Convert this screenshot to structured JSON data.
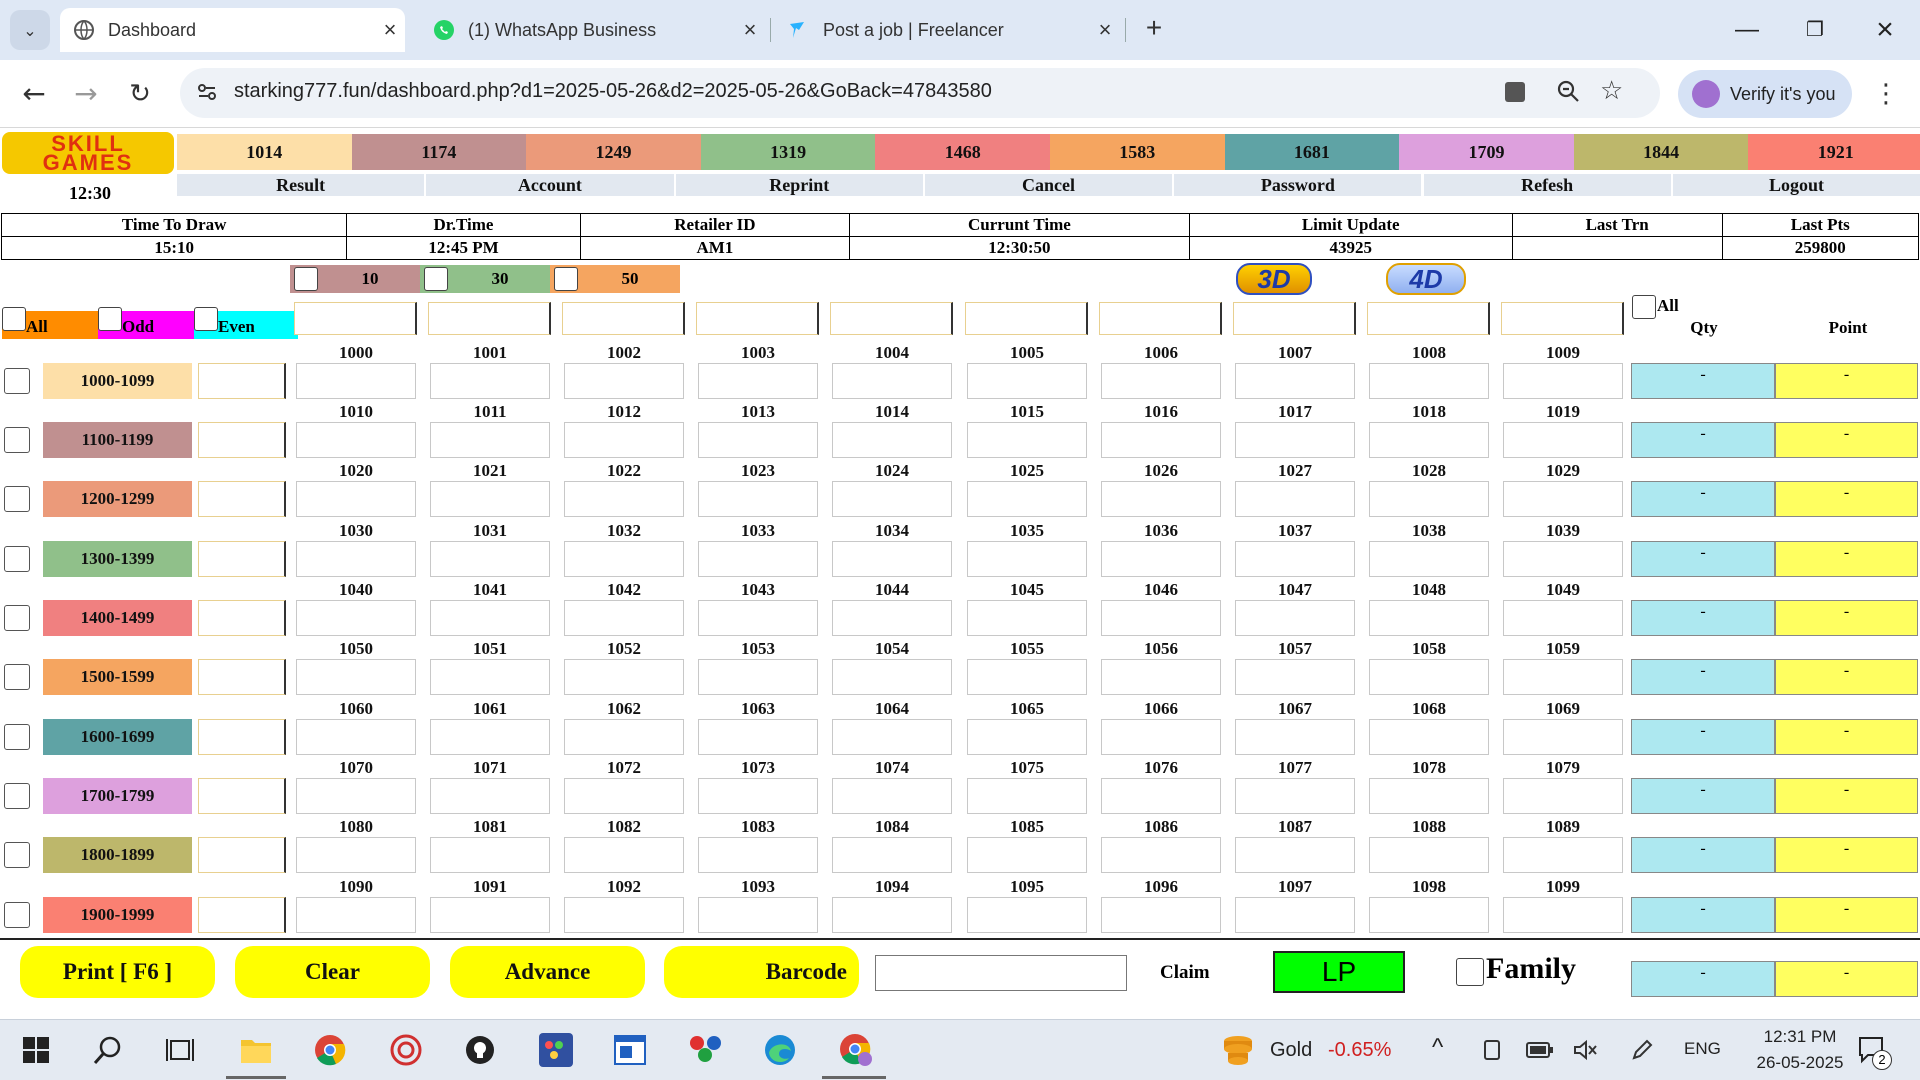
{
  "browser": {
    "tabs": [
      {
        "title": "Dashboard",
        "active": true
      },
      {
        "title": "(1) WhatsApp Business",
        "active": false
      },
      {
        "title": "Post a job | Freelancer",
        "active": false
      }
    ],
    "url": "starking777.fun/dashboard.php?d1=2025-05-26&d2=2025-05-26&GoBack=47843580",
    "verify_label": "Verify it's you"
  },
  "header": {
    "logo_line1": "SKILL",
    "logo_line2": "GAMES",
    "clock": "12:30",
    "color_numbers": [
      {
        "label": "1014",
        "color": "#fddfa8"
      },
      {
        "label": "1174",
        "color": "#c09090"
      },
      {
        "label": "1249",
        "color": "#eb9a7a"
      },
      {
        "label": "1319",
        "color": "#90c08a"
      },
      {
        "label": "1468",
        "color": "#f08080"
      },
      {
        "label": "1583",
        "color": "#f5a560"
      },
      {
        "label": "1681",
        "color": "#5fa3a5"
      },
      {
        "label": "1709",
        "color": "#dda0dd"
      },
      {
        "label": "1844",
        "color": "#bdb76b"
      },
      {
        "label": "1921",
        "color": "#fa8072"
      }
    ],
    "nav": [
      "Result",
      "Account",
      "Reprint",
      "Cancel",
      "Password",
      "Refesh",
      "Logout"
    ]
  },
  "info": {
    "headers": [
      "Time To Draw",
      "Dr.Time",
      "Retailer ID",
      "Currunt Time",
      "Limit Update",
      "Last Trn",
      "Last Pts"
    ],
    "values": [
      "15:10",
      "12:45 PM",
      "AM1",
      "12:30:50",
      "43925",
      "",
      "259800"
    ]
  },
  "multipliers": [
    {
      "label": "10",
      "color": "#c09090"
    },
    {
      "label": "30",
      "color": "#90c08a"
    },
    {
      "label": "50",
      "color": "#f5a560"
    }
  ],
  "mode_labels": {
    "d3": "3D",
    "d4": "4D"
  },
  "filters": [
    {
      "label": "All",
      "color": "#ff8c00"
    },
    {
      "label": "Odd",
      "color": "#ff00ff"
    },
    {
      "label": "Even",
      "color": "#00ffff"
    }
  ],
  "all_label": "All",
  "col_headers": {
    "qty": "Qty",
    "point": "Point"
  },
  "rows": [
    {
      "range": "1000-1099",
      "color": "#fddfa8",
      "numbers": [
        "1000",
        "1001",
        "1002",
        "1003",
        "1004",
        "1005",
        "1006",
        "1007",
        "1008",
        "1009"
      ],
      "qty": "-",
      "point": "-"
    },
    {
      "range": "1100-1199",
      "color": "#c09090",
      "numbers": [
        "1010",
        "1011",
        "1012",
        "1013",
        "1014",
        "1015",
        "1016",
        "1017",
        "1018",
        "1019"
      ],
      "qty": "-",
      "point": "-"
    },
    {
      "range": "1200-1299",
      "color": "#eb9a7a",
      "numbers": [
        "1020",
        "1021",
        "1022",
        "1023",
        "1024",
        "1025",
        "1026",
        "1027",
        "1028",
        "1029"
      ],
      "qty": "-",
      "point": "-"
    },
    {
      "range": "1300-1399",
      "color": "#90c08a",
      "numbers": [
        "1030",
        "1031",
        "1032",
        "1033",
        "1034",
        "1035",
        "1036",
        "1037",
        "1038",
        "1039"
      ],
      "qty": "-",
      "point": "-"
    },
    {
      "range": "1400-1499",
      "color": "#f08080",
      "numbers": [
        "1040",
        "1041",
        "1042",
        "1043",
        "1044",
        "1045",
        "1046",
        "1047",
        "1048",
        "1049"
      ],
      "qty": "-",
      "point": "-"
    },
    {
      "range": "1500-1599",
      "color": "#f5a560",
      "numbers": [
        "1050",
        "1051",
        "1052",
        "1053",
        "1054",
        "1055",
        "1056",
        "1057",
        "1058",
        "1059"
      ],
      "qty": "-",
      "point": "-"
    },
    {
      "range": "1600-1699",
      "color": "#5fa3a5",
      "numbers": [
        "1060",
        "1061",
        "1062",
        "1063",
        "1064",
        "1065",
        "1066",
        "1067",
        "1068",
        "1069"
      ],
      "qty": "-",
      "point": "-"
    },
    {
      "range": "1700-1799",
      "color": "#dda0dd",
      "numbers": [
        "1070",
        "1071",
        "1072",
        "1073",
        "1074",
        "1075",
        "1076",
        "1077",
        "1078",
        "1079"
      ],
      "qty": "-",
      "point": "-"
    },
    {
      "range": "1800-1899",
      "color": "#bdb76b",
      "numbers": [
        "1080",
        "1081",
        "1082",
        "1083",
        "1084",
        "1085",
        "1086",
        "1087",
        "1088",
        "1089"
      ],
      "qty": "-",
      "point": "-"
    },
    {
      "range": "1900-1999",
      "color": "#fa8072",
      "numbers": [
        "1090",
        "1091",
        "1092",
        "1093",
        "1094",
        "1095",
        "1096",
        "1097",
        "1098",
        "1099"
      ],
      "qty": "-",
      "point": "-"
    }
  ],
  "footer": {
    "print": "Print [ F6 ]",
    "clear": "Clear",
    "advance": "Advance",
    "barcode": "Barcode",
    "claim": "Claim",
    "lp": "LP",
    "family": "Family",
    "total_qty": "-",
    "total_point": "-"
  },
  "taskbar": {
    "gold_label": "Gold",
    "gold_change": "-0.65%",
    "lang": "ENG",
    "time": "12:31 PM",
    "date": "26-05-2025",
    "notif_count": "2"
  }
}
